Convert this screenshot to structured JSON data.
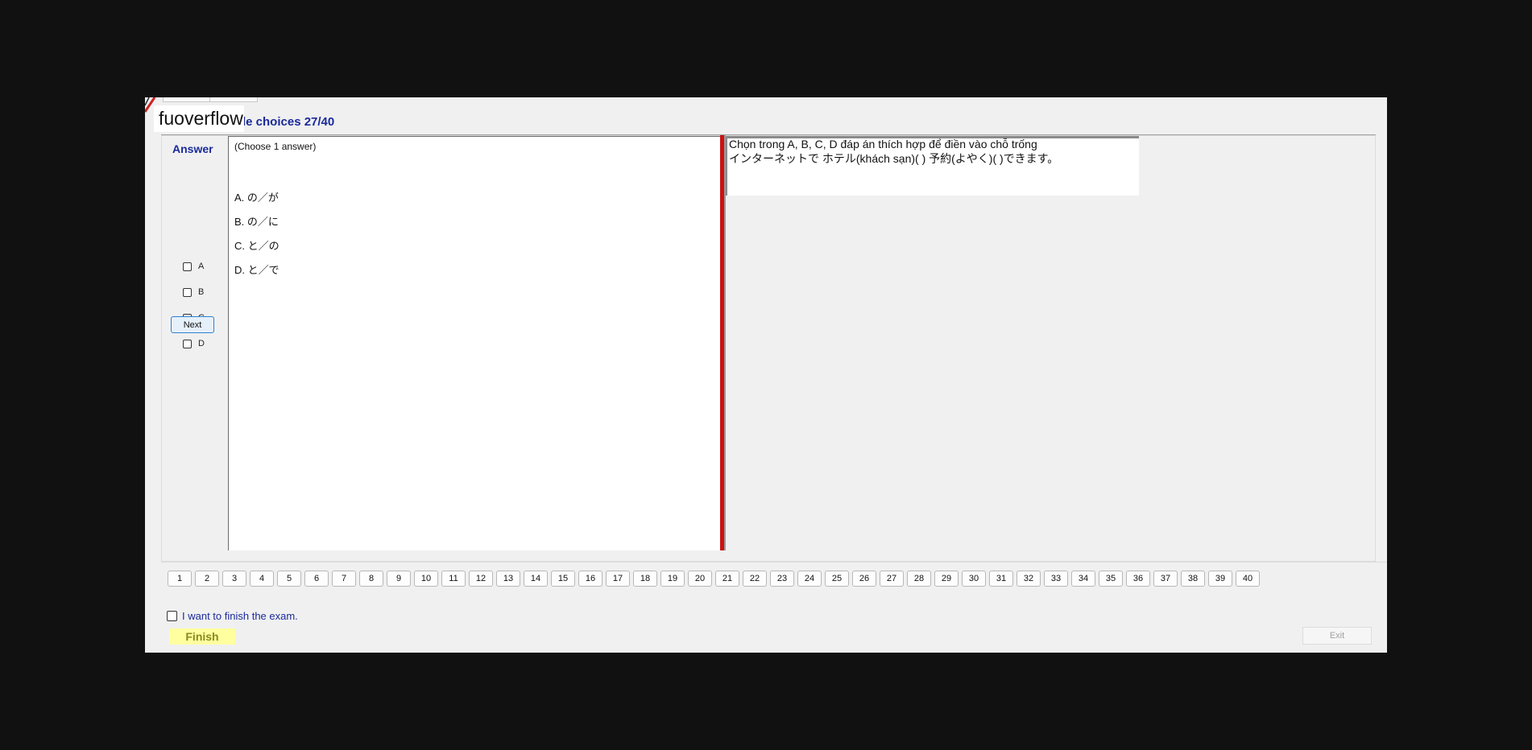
{
  "header": {
    "watermark": "fuoverflow",
    "section_title": "le choices 27/40"
  },
  "answer_panel": {
    "label": "Answer",
    "options": [
      "A",
      "B",
      "C",
      "D"
    ],
    "next_label": "Next"
  },
  "question": {
    "instruction": "(Choose 1 answer)",
    "choices": [
      "A. の／が",
      "B. の／に",
      "C. と／の",
      "D. と／で"
    ]
  },
  "passage": {
    "line1": "Chọn trong A, B, C, D đáp án thích hợp để điền vào chỗ trống",
    "line2": "インターネットで  ホテル(khách sạn)(          ) 予約(よやく)(          )できます。"
  },
  "question_numbers": [
    "1",
    "2",
    "3",
    "4",
    "5",
    "6",
    "7",
    "8",
    "9",
    "10",
    "11",
    "12",
    "13",
    "14",
    "15",
    "16",
    "17",
    "18",
    "19",
    "20",
    "21",
    "22",
    "23",
    "24",
    "25",
    "26",
    "27",
    "28",
    "29",
    "30",
    "31",
    "32",
    "33",
    "34",
    "35",
    "36",
    "37",
    "38",
    "39",
    "40"
  ],
  "footer": {
    "finish_checkbox_label": "I want to finish the exam.",
    "finish_label": "Finish",
    "exit_label": "Exit"
  },
  "colors": {
    "accent_blue": "#1a2a9a",
    "splitter_red": "#cc1111",
    "finish_yellow": "#ffffa0"
  }
}
